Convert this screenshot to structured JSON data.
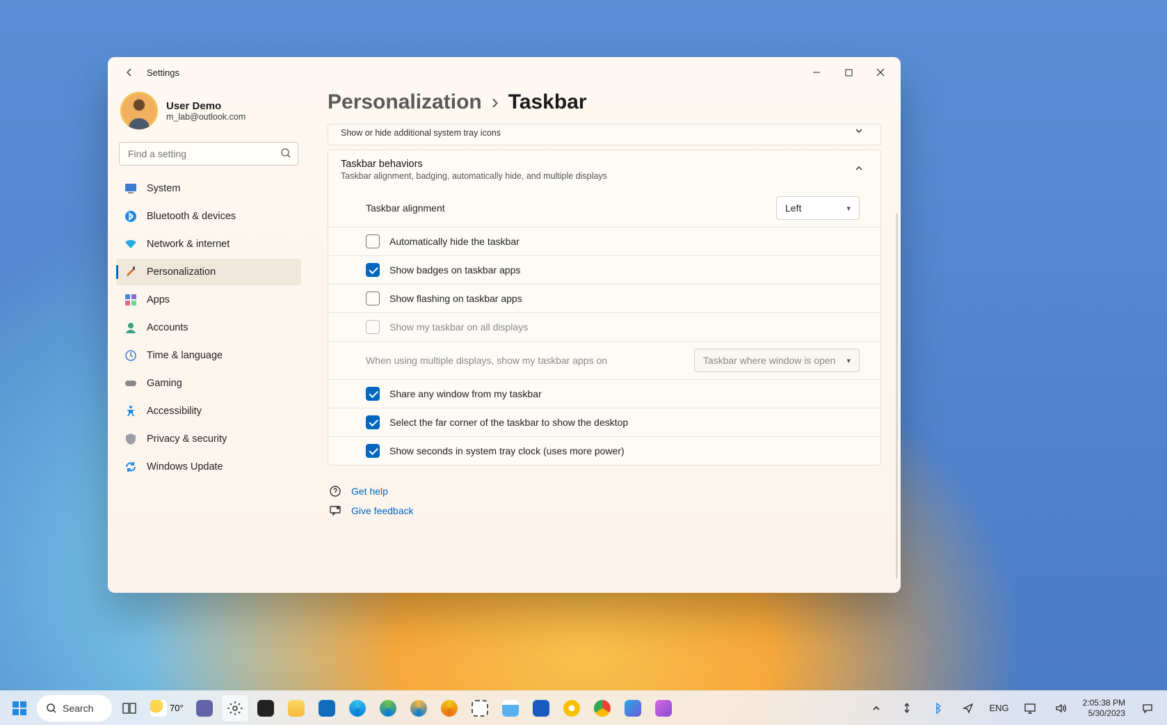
{
  "window": {
    "app_name": "Settings"
  },
  "profile": {
    "name": "User Demo",
    "email": "m_lab@outlook.com"
  },
  "search": {
    "placeholder": "Find a setting"
  },
  "sidebar": {
    "items": [
      {
        "label": "System"
      },
      {
        "label": "Bluetooth & devices"
      },
      {
        "label": "Network & internet"
      },
      {
        "label": "Personalization"
      },
      {
        "label": "Apps"
      },
      {
        "label": "Accounts"
      },
      {
        "label": "Time & language"
      },
      {
        "label": "Gaming"
      },
      {
        "label": "Accessibility"
      },
      {
        "label": "Privacy & security"
      },
      {
        "label": "Windows Update"
      }
    ],
    "active_index": 3
  },
  "breadcrumb": {
    "parent": "Personalization",
    "current": "Taskbar"
  },
  "collapsed_strip": {
    "subtitle": "Show or hide additional system tray icons"
  },
  "behaviors": {
    "title": "Taskbar behaviors",
    "subtitle": "Taskbar alignment, badging, automatically hide, and multiple displays",
    "alignment": {
      "label": "Taskbar alignment",
      "value": "Left"
    },
    "rows": [
      {
        "label": "Automatically hide the taskbar",
        "checked": false,
        "disabled": false
      },
      {
        "label": "Show badges on taskbar apps",
        "checked": true,
        "disabled": false
      },
      {
        "label": "Show flashing on taskbar apps",
        "checked": false,
        "disabled": false
      },
      {
        "label": "Show my taskbar on all displays",
        "checked": false,
        "disabled": true
      }
    ],
    "multi_display": {
      "label": "When using multiple displays, show my taskbar apps on",
      "value": "Taskbar where window is open",
      "disabled": true
    },
    "rows2": [
      {
        "label": "Share any window from my taskbar",
        "checked": true
      },
      {
        "label": "Select the far corner of the taskbar to show the desktop",
        "checked": true
      },
      {
        "label": "Show seconds in system tray clock (uses more power)",
        "checked": true
      }
    ]
  },
  "links": {
    "help": "Get help",
    "feedback": "Give feedback"
  },
  "taskbar": {
    "search_label": "Search",
    "weather_temp": "70°",
    "lang": "ENG",
    "time": "2:05:38 PM",
    "date": "5/30/2023"
  }
}
